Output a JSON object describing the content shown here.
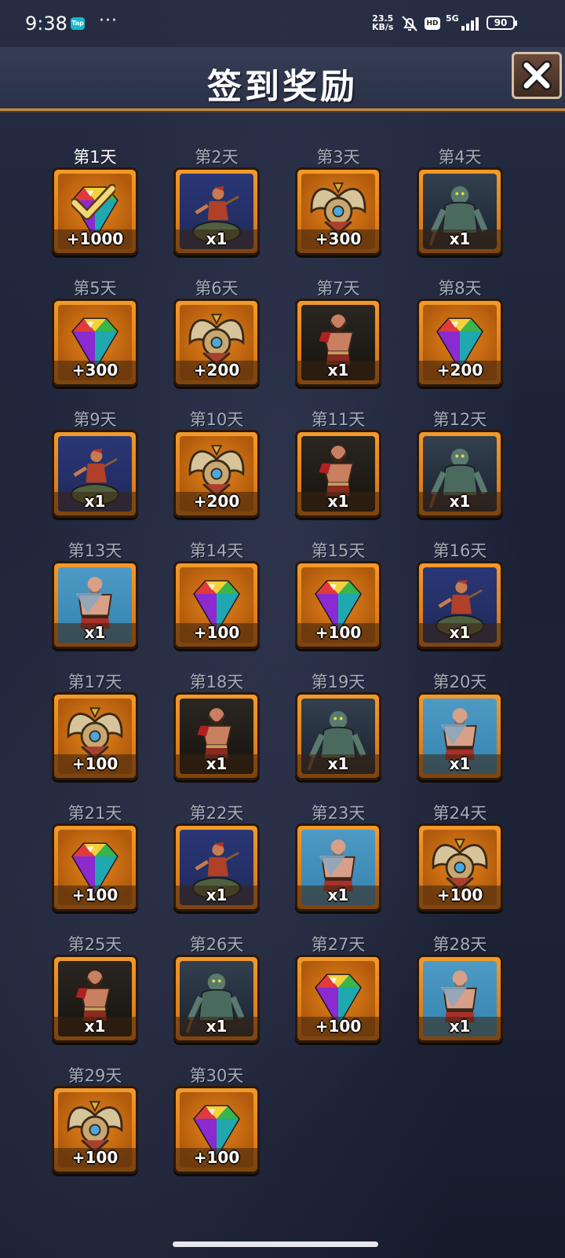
{
  "status": {
    "time": "9:38",
    "tap_badge": "Tap",
    "dots": "···",
    "speed_value": "23.5",
    "speed_unit": "KB/s",
    "hd": "HD",
    "network": "5G",
    "battery": "90"
  },
  "header": {
    "title": "签到奖励"
  },
  "rewards": [
    {
      "day": "第1天",
      "amount": "+1000",
      "kind": "gem",
      "claimed": true
    },
    {
      "day": "第2天",
      "amount": "x1",
      "kind": "rider"
    },
    {
      "day": "第3天",
      "amount": "+300",
      "kind": "medal"
    },
    {
      "day": "第4天",
      "amount": "x1",
      "kind": "ogre"
    },
    {
      "day": "第5天",
      "amount": "+300",
      "kind": "gem"
    },
    {
      "day": "第6天",
      "amount": "+200",
      "kind": "medal"
    },
    {
      "day": "第7天",
      "amount": "x1",
      "kind": "warrior"
    },
    {
      "day": "第8天",
      "amount": "+200",
      "kind": "gem"
    },
    {
      "day": "第9天",
      "amount": "x1",
      "kind": "rider"
    },
    {
      "day": "第10天",
      "amount": "+200",
      "kind": "medal"
    },
    {
      "day": "第11天",
      "amount": "x1",
      "kind": "warrior"
    },
    {
      "day": "第12天",
      "amount": "x1",
      "kind": "ogre"
    },
    {
      "day": "第13天",
      "amount": "x1",
      "kind": "barbarian"
    },
    {
      "day": "第14天",
      "amount": "+100",
      "kind": "gem"
    },
    {
      "day": "第15天",
      "amount": "+100",
      "kind": "gem"
    },
    {
      "day": "第16天",
      "amount": "x1",
      "kind": "rider"
    },
    {
      "day": "第17天",
      "amount": "+100",
      "kind": "medal"
    },
    {
      "day": "第18天",
      "amount": "x1",
      "kind": "warrior"
    },
    {
      "day": "第19天",
      "amount": "x1",
      "kind": "ogre"
    },
    {
      "day": "第20天",
      "amount": "x1",
      "kind": "barbarian"
    },
    {
      "day": "第21天",
      "amount": "+100",
      "kind": "gem"
    },
    {
      "day": "第22天",
      "amount": "x1",
      "kind": "rider"
    },
    {
      "day": "第23天",
      "amount": "x1",
      "kind": "barbarian"
    },
    {
      "day": "第24天",
      "amount": "+100",
      "kind": "medal"
    },
    {
      "day": "第25天",
      "amount": "x1",
      "kind": "warrior"
    },
    {
      "day": "第26天",
      "amount": "x1",
      "kind": "ogre"
    },
    {
      "day": "第27天",
      "amount": "+100",
      "kind": "gem"
    },
    {
      "day": "第28天",
      "amount": "x1",
      "kind": "barbarian"
    },
    {
      "day": "第29天",
      "amount": "+100",
      "kind": "medal"
    },
    {
      "day": "第30天",
      "amount": "+100",
      "kind": "gem"
    }
  ]
}
